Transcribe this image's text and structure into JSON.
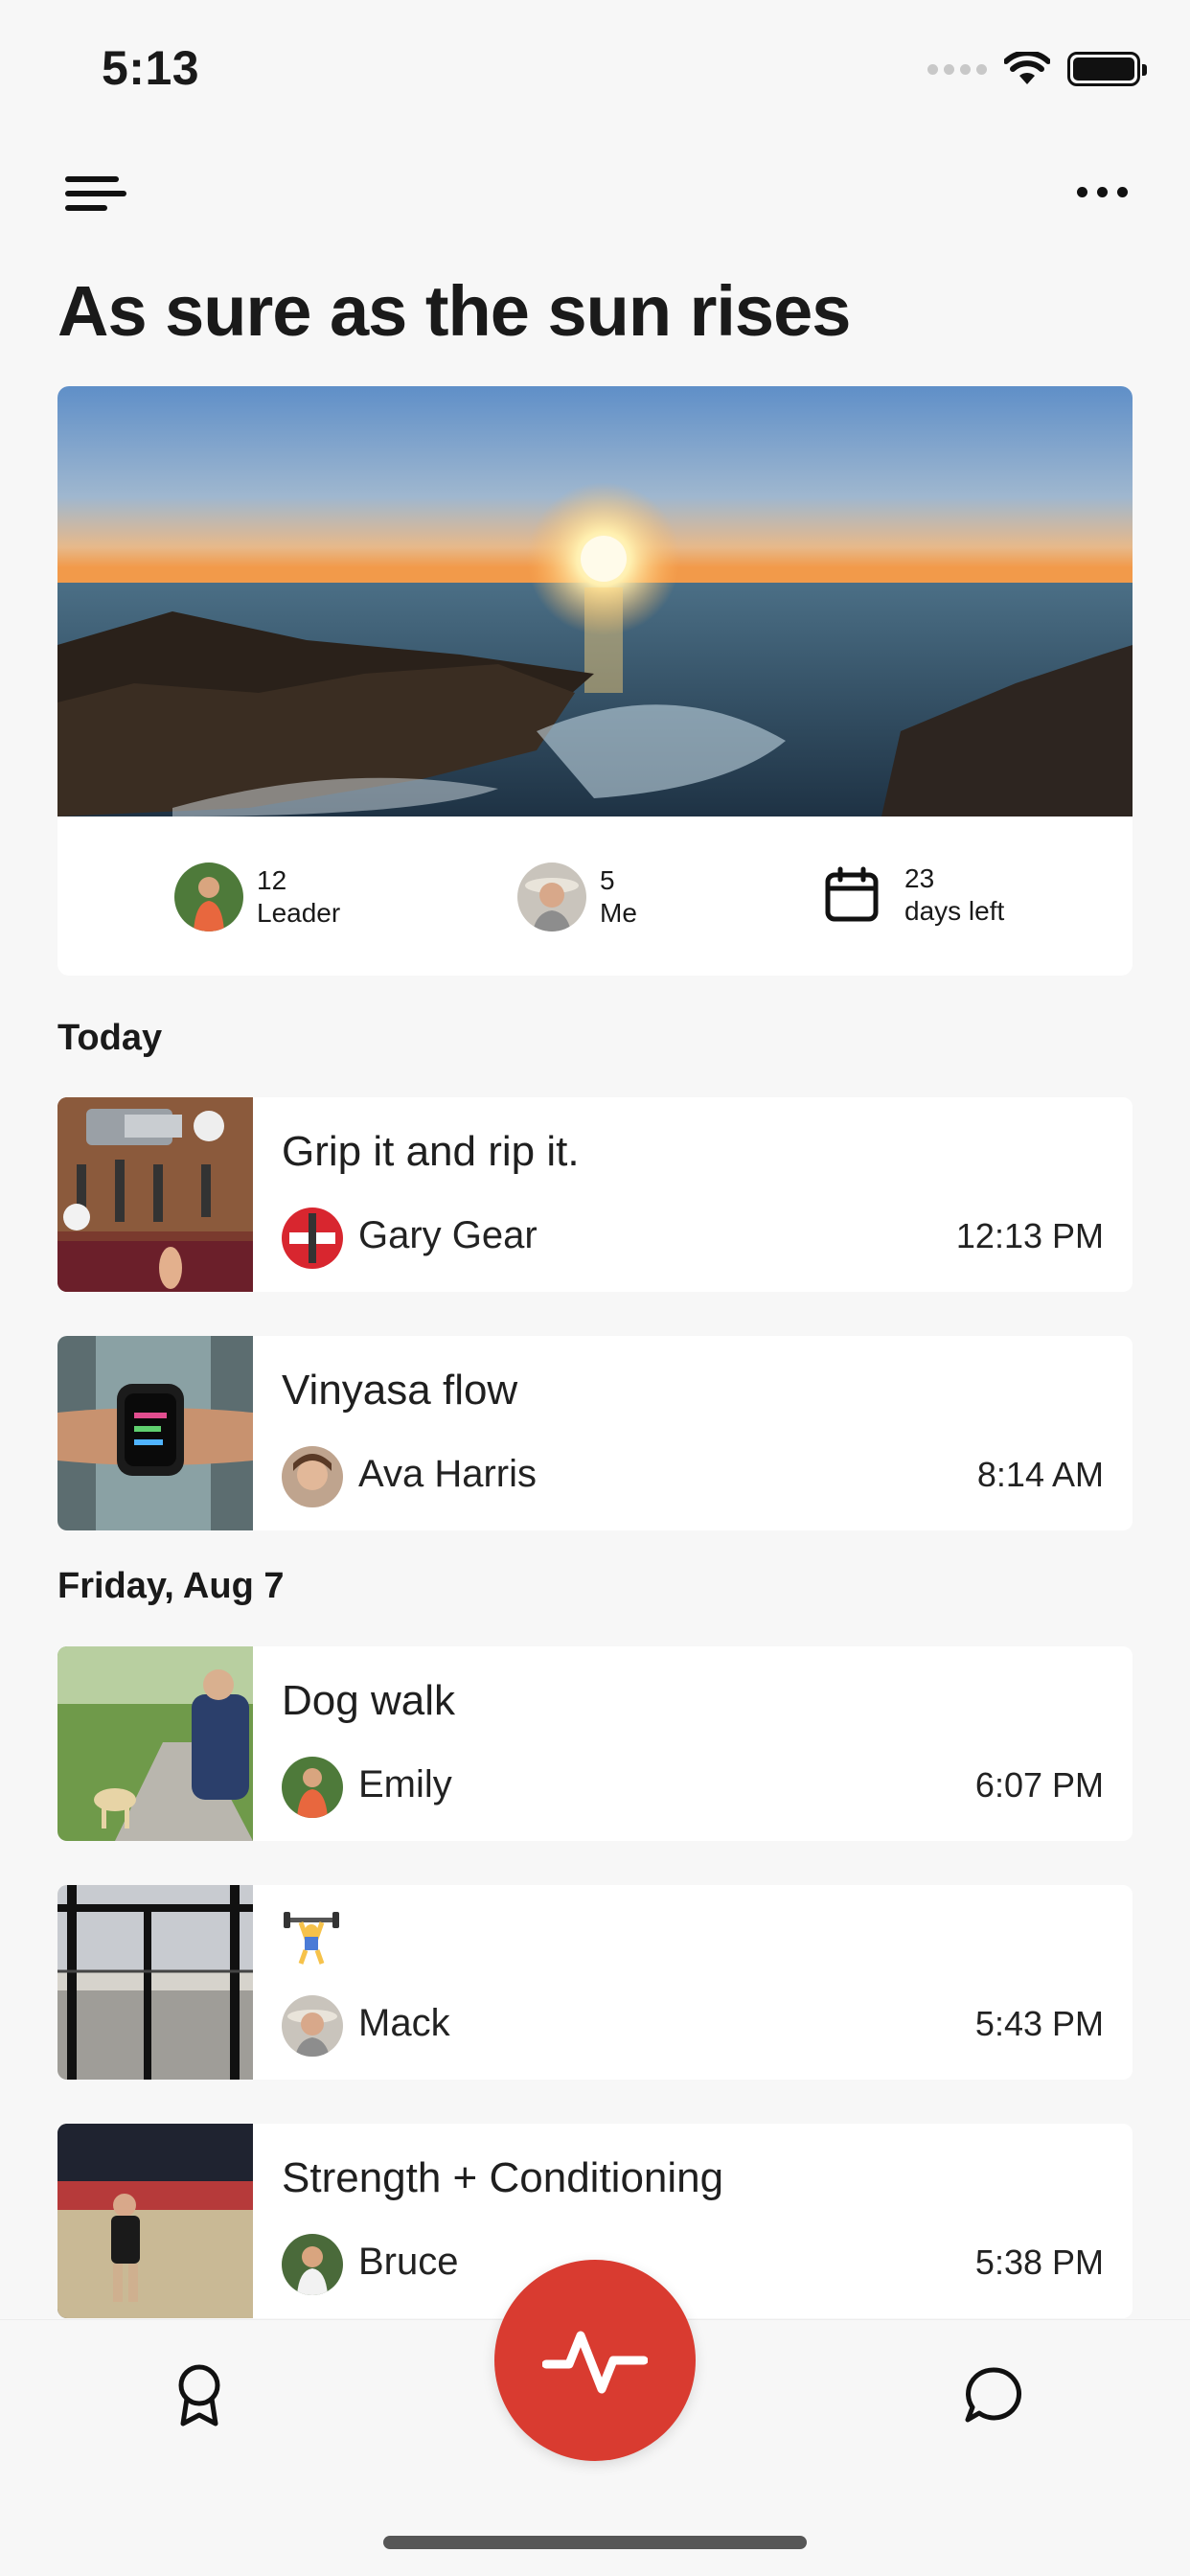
{
  "status_bar": {
    "time": "5:13"
  },
  "header": {
    "title": "As sure as the sun rises"
  },
  "challenge_stats": {
    "leader": {
      "value": "12",
      "label": "Leader"
    },
    "me": {
      "value": "5",
      "label": "Me"
    },
    "days": {
      "value": "23",
      "label": "days left"
    }
  },
  "feed": {
    "sections": [
      {
        "title": "Today",
        "items": [
          {
            "title": "Grip it and rip it.",
            "user": "Gary Gear",
            "time": "12:13 PM"
          },
          {
            "title": "Vinyasa flow",
            "user": "Ava Harris",
            "time": "8:14 AM"
          }
        ]
      },
      {
        "title": "Friday, Aug 7",
        "items": [
          {
            "title": "Dog walk",
            "user": "Emily",
            "time": "6:07 PM"
          },
          {
            "title": "",
            "emoji": "weightlifter-icon",
            "user": "Mack",
            "time": "5:43 PM"
          },
          {
            "title": "Strength + Conditioning",
            "user": "Bruce",
            "time": "5:38 PM"
          }
        ]
      }
    ]
  },
  "colors": {
    "accent": "#d93b30",
    "background": "#f7f7f7",
    "card": "#ffffff"
  },
  "tabbar": {
    "left_icon": "award-icon",
    "center_icon": "activity-pulse-icon",
    "right_icon": "chat-bubble-icon"
  }
}
